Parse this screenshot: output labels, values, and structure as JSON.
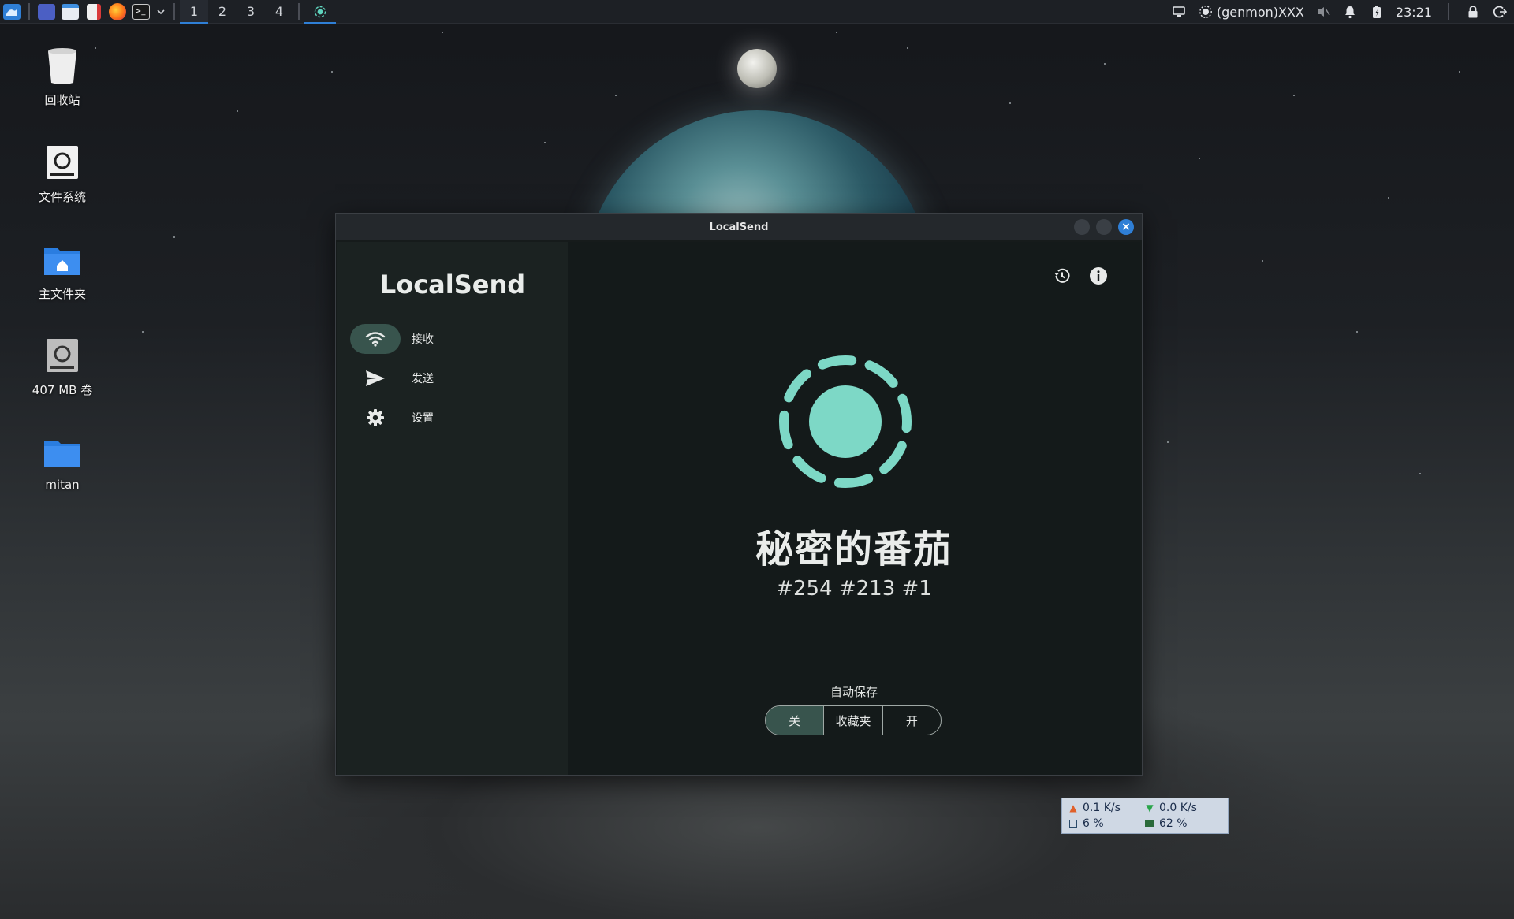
{
  "taskbar": {
    "workspaces": [
      "1",
      "2",
      "3",
      "4"
    ],
    "active_workspace": "1",
    "genmon_label": "(genmon)XXX",
    "clock": "23:21"
  },
  "desktop_icons": [
    {
      "label": "回收站",
      "icon": "trash-icon"
    },
    {
      "label": "文件系统",
      "icon": "drive-icon"
    },
    {
      "label": "主文件夹",
      "icon": "home-folder-icon"
    },
    {
      "label": "407 MB 卷",
      "icon": "drive-icon"
    },
    {
      "label": "mitan",
      "icon": "folder-icon"
    }
  ],
  "window": {
    "title": "LocalSend",
    "app_title": "LocalSend",
    "nav": [
      {
        "label": "接收",
        "icon": "wifi-icon",
        "active": true
      },
      {
        "label": "发送",
        "icon": "send-icon",
        "active": false
      },
      {
        "label": "设置",
        "icon": "gear-icon",
        "active": false
      }
    ],
    "device_name": "秘密的番茄",
    "device_tags": "#254 #213 #1",
    "autosave": {
      "label": "自动保存",
      "options": [
        "关",
        "收藏夹",
        "开"
      ],
      "selected": "关"
    },
    "accent_color": "#7dd8c6"
  },
  "netmon": {
    "upload": "0.1 K/s",
    "download": "0.0 K/s",
    "cpu": "6 %",
    "mem": "62 %"
  }
}
